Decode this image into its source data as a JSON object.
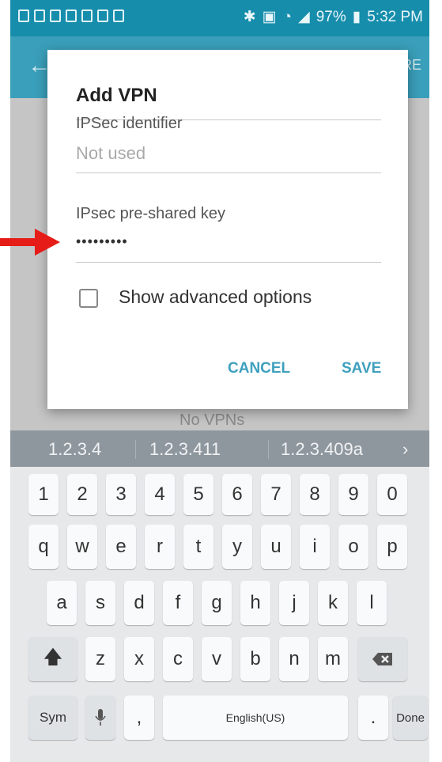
{
  "status_bar": {
    "time": "5:32 PM",
    "battery": "97%"
  },
  "appbar": {
    "back_icon": "arrow-left-icon",
    "action_partial": "RE"
  },
  "behind": {
    "text": "No VPNs"
  },
  "dialog": {
    "title": "Add VPN",
    "field1_label": "IPSec identifier",
    "field1_value": "Not used",
    "field2_label": "IPsec pre-shared key",
    "field2_value": "•••••••••",
    "checkbox_label": "Show advanced options",
    "cancel": "CANCEL",
    "save": "SAVE"
  },
  "suggestions": [
    "1.2.3.4",
    "1.2.3.411",
    "1.2.3.409a"
  ],
  "keyboard": {
    "row1": [
      "1",
      "2",
      "3",
      "4",
      "5",
      "6",
      "7",
      "8",
      "9",
      "0"
    ],
    "row2": [
      "q",
      "w",
      "e",
      "r",
      "t",
      "y",
      "u",
      "i",
      "o",
      "p"
    ],
    "row3": [
      "a",
      "s",
      "d",
      "f",
      "g",
      "h",
      "j",
      "k",
      "l"
    ],
    "row4": [
      "z",
      "x",
      "c",
      "v",
      "b",
      "n",
      "m"
    ],
    "sym": "Sym",
    "comma": ",",
    "space": "English(US)",
    "period": ".",
    "done": "Done"
  },
  "annotation": {
    "arrow_color": "#e51c17"
  }
}
